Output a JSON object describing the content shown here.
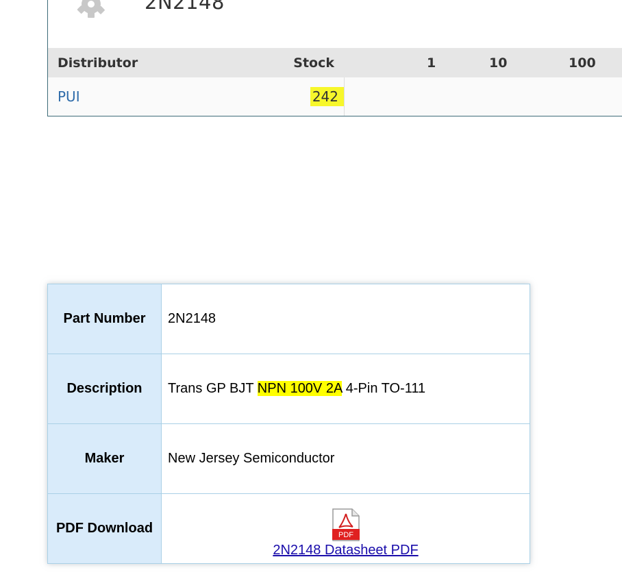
{
  "header": {
    "part_title": "2N2148"
  },
  "distributor_table": {
    "columns": [
      "Distributor",
      "Stock",
      "1",
      "10",
      "100"
    ],
    "rows": [
      {
        "distributor": "PUI",
        "stock": "242"
      }
    ]
  },
  "details": {
    "part_number_label": "Part Number",
    "part_number_value": "2N2148",
    "description_label": "Description",
    "description_prefix": "Trans GP BJT ",
    "description_highlight": "NPN 100V 2A",
    "description_suffix": " 4-Pin TO-111",
    "maker_label": "Maker",
    "maker_value": "New Jersey Semiconductor",
    "pdf_label": "PDF Download",
    "pdf_icon_text": "PDF",
    "pdf_link_text": "2N2148 Datasheet PDF"
  },
  "colors": {
    "highlight": "#ffff00",
    "label_bg": "#d9ebfa",
    "link": "#1a0dab",
    "distributor_link": "#2f6caa"
  }
}
